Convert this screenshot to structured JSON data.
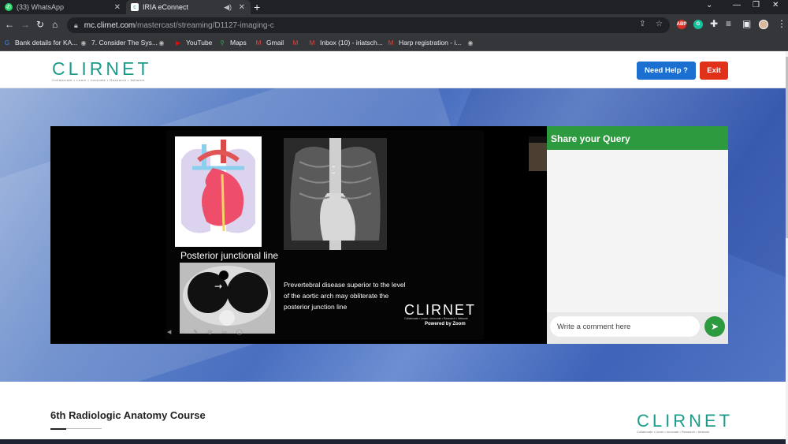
{
  "browser": {
    "tabs": [
      {
        "title": "(33) WhatsApp",
        "icon": "whatsapp-icon"
      },
      {
        "title": "IRIA eConnect",
        "icon": "clirnet-icon"
      }
    ],
    "url_host": "mc.clirnet.com",
    "url_path": "/mastercast/streaming/D1127-imaging-c",
    "bookmarks": [
      "Bank details for KA...",
      "7. Consider The Sys...",
      "YouTube",
      "Maps",
      "Gmail",
      "Inbox (10) - iriatsch...",
      "Harp registration - i..."
    ],
    "extensions": [
      "ABP",
      "G"
    ]
  },
  "header": {
    "logo_text": "CLIRNET",
    "logo_tagline": "Collaborate • Learn • Innovate • Research • Network",
    "help_label": "Need Help ?",
    "exit_label": "Exit"
  },
  "slide": {
    "label": "Posterior junctional line",
    "caption": "Prevertebral disease superior to the level of the aortic arch may obliterate the posterior junction line",
    "watermark": "CLIRNET",
    "watermark_tag": "Collaborate • Learn • Innovate • Research • Network",
    "powered": "Powered by Zoom"
  },
  "query": {
    "title": "Share your Query",
    "placeholder": "Write a comment here"
  },
  "course": {
    "title": "6th Radiologic Anatomy Course"
  },
  "colors": {
    "brand_teal": "#1c9a8a",
    "help_blue": "#1a6fd1",
    "exit_red": "#e0321b",
    "query_green": "#2e9a3f"
  }
}
